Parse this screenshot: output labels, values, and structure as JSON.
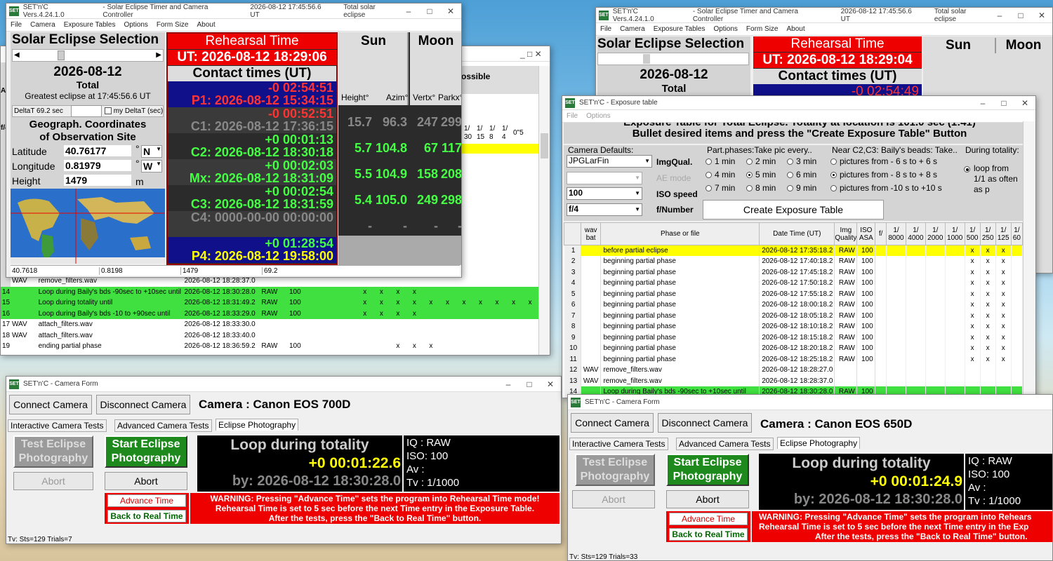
{
  "app_short": "SET'n'C",
  "left_main": {
    "title_parts": [
      "SET'n'C  Vers.4.24.1.0",
      "- Solar Eclipse Timer and Camera Controller",
      "2026-08-12  17:45:56.6 UT",
      "Total solar eclipse"
    ],
    "menu": [
      "File",
      "Camera",
      "Exposure Tables",
      "Options",
      "Form Size",
      "About"
    ],
    "ses_title": "Solar Eclipse Selection",
    "date": "2026-08-12",
    "type": "Total",
    "greatest": "Greatest eclipse at 17:45:56.6 UT",
    "deltat_label": "DeltaT 69.2 sec",
    "my_deltat": "my DeltaT (sec)",
    "geo_title1": "Geograph. Coordinates",
    "geo_title2": "of Observation Site",
    "lat_label": "Latitude",
    "lat": "40.76177",
    "lat_dir": "N",
    "lon_label": "Longitude",
    "lon": "0.81979",
    "lon_dir": "W",
    "h_label": "Height",
    "h": "1479",
    "h_unit": "m",
    "deg": "°",
    "status": [
      "40.7618",
      "0.8198",
      "1479",
      "69.2"
    ],
    "reh_title": "Rehearsal Time",
    "ut": "UT: 2026-08-12 18:29:06",
    "contact_title": "Contact times (UT)",
    "sun": "Sun",
    "moon": "Moon",
    "hdr": [
      "Height°",
      "Azim°",
      "Vertx°",
      "Parkx°"
    ],
    "contacts": [
      {
        "off": "-0 02:54:51",
        "lbl": "P1: 2026-08-12 15:34:15",
        "sh": "",
        "sa": "",
        "mv": "",
        "mp": ""
      },
      {
        "off": "-0 00:52:51",
        "lbl": "C1: 2026-08-12 17:36:15",
        "sh": "15.7",
        "sa": "96.3",
        "mv": "247",
        "mp": "299"
      },
      {
        "off": "+0 00:01:13",
        "lbl": "C2: 2026-08-12 18:30:18",
        "sh": "5.7",
        "sa": "104.8",
        "mv": "67",
        "mp": "117"
      },
      {
        "off": "+0 00:02:03",
        "lbl": "Mx: 2026-08-12 18:31:09",
        "sh": "5.5",
        "sa": "104.9",
        "mv": "158",
        "mp": "208"
      },
      {
        "off": "+0 00:02:54",
        "lbl": "C3: 2026-08-12 18:31:59",
        "sh": "5.4",
        "sa": "105.0",
        "mv": "249",
        "mp": "298"
      },
      {
        "off": "",
        "lbl": "C4: 0000-00-00 00:00:00",
        "sh": "-",
        "sa": "-",
        "mv": "-",
        "mp": "-"
      },
      {
        "off": "+0 01:28:54",
        "lbl": "P4: 2026-08-12 19:58:00",
        "sh": "",
        "sa": "",
        "mv": "",
        "mp": ""
      }
    ]
  },
  "left_table": {
    "partial_text": "ossible",
    "hdr_fracs": [
      "1/",
      "1/",
      "1/",
      "1/",
      "1/"
    ],
    "hdr_nums": [
      "30",
      "15",
      "8",
      "4"
    ],
    "hdr_last": "0\"5",
    "rows": [
      {
        "n": "",
        "wav": "WAV",
        "phase": "remove_filters.wav",
        "date": "2026-08-12 18:28:37.0",
        "iq": "",
        "iso": "",
        "marks": [],
        "color": ""
      },
      {
        "n": "14",
        "wav": "",
        "phase": "Loop during Baily's bds -90sec to +10sec until",
        "date": "2026-08-12 18:30:28.0",
        "iq": "RAW",
        "iso": "100",
        "marks": [
          "x",
          "x",
          "x",
          "x",
          "",
          "",
          "",
          "",
          "",
          "",
          ""
        ],
        "color": "grn"
      },
      {
        "n": "15",
        "wav": "",
        "phase": "Loop during totality until",
        "date": "2026-08-12 18:31:49.2",
        "iq": "RAW",
        "iso": "100",
        "marks": [
          "x",
          "x",
          "x",
          "x",
          "x",
          "x",
          "x",
          "x",
          "x",
          "x",
          "x"
        ],
        "color": "grn"
      },
      {
        "n": "16",
        "wav": "",
        "phase": "Loop during Baily's bds -10 to +90sec until",
        "date": "2026-08-12 18:33:29.0",
        "iq": "RAW",
        "iso": "100",
        "marks": [
          "x",
          "x",
          "x",
          "x",
          "",
          "",
          "",
          "",
          "",
          "",
          ""
        ],
        "color": "grn"
      },
      {
        "n": "17",
        "wav": "WAV",
        "phase": "attach_filters.wav",
        "date": "2026-08-12 18:33:30.0",
        "iq": "",
        "iso": "",
        "marks": [],
        "color": ""
      },
      {
        "n": "18",
        "wav": "WAV",
        "phase": "attach_filters.wav",
        "date": "2026-08-12 18:33:40.0",
        "iq": "",
        "iso": "",
        "marks": [],
        "color": ""
      },
      {
        "n": "19",
        "wav": "",
        "phase": "ending partial phase",
        "date": "2026-08-12 18:36:59.2",
        "iq": "RAW",
        "iso": "100",
        "marks": [
          "",
          "",
          "x",
          "x",
          "x"
        ],
        "color": ""
      }
    ]
  },
  "left_cam": {
    "title": "SET'n'C - Camera Form",
    "connect": "Connect Camera",
    "disconnect": "Disconnect Camera",
    "camera": "Camera : Canon EOS 700D",
    "tabs": [
      "Interactive Camera Tests",
      "Advanced Camera Tests",
      "Eclipse Photography"
    ],
    "test": "Test Eclipse Photography",
    "start": "Start Eclipse Photography",
    "abort1": "Abort",
    "abort2": "Abort",
    "loop": "Loop during totality",
    "timer": "+0 00:01:22.6",
    "by": "by: 2026-08-12 18:30:28.0",
    "iq": "IQ  : RAW",
    "iso": "ISO: 100",
    "av": "Av  :",
    "tv": "Tv  : 1/1000",
    "adv": "Advance Time",
    "back": "Back to Real Time",
    "warn1": "WARNING: Pressing \"Advance Time\" sets the program into Rehearsal Time mode!",
    "warn2": "Rehearsal Time is set to 5 sec before the next Time entry in the Exposure Table.",
    "warn3": "After the tests, press the \"Back to Real Time\" button.",
    "status": "Tv: Sts=129 Trials=7"
  },
  "right_main": {
    "date": "2026-08-12",
    "type": "Total",
    "ut": "UT: 2026-08-12 18:29:04",
    "off": "-0 02:54:49"
  },
  "exposure": {
    "title": "SET'n'C - Exposure table",
    "menu": [
      "File",
      "Options"
    ],
    "head1": "Exposure Table for Total Eclipse. Totality at location is 101.0 sec (1:41)",
    "head2": "Bullet desired items and press the \"Create Exposure Table\" Button",
    "cam_def": "Camera Defaults:",
    "imgqual_v": "JPGLarFin",
    "imgqual": "ImgQual.",
    "ae": "AE mode",
    "iso_v": "100",
    "iso": "ISO speed",
    "f_v": "f/4",
    "fnum": "f/Number",
    "pp_title": "Part.phases:Take pic every..",
    "pp": [
      "1 min",
      "2 min",
      "3 min",
      "4 min",
      "5 min",
      "6 min",
      "7 min",
      "8 min",
      "9 min"
    ],
    "bb_title": "Near C2,C3: Baily's beads: Take..",
    "bb": [
      "pictures from  - 6 s to  + 6 s",
      "pictures from  - 8 s to  + 8 s",
      "pictures from -10 s to +10 s"
    ],
    "tot_title": "During totality:",
    "tot": "loop from 1/1 as often as p",
    "create": "Create Exposure Table",
    "cols": [
      "wav bat",
      "Phase or file",
      "Date Time (UT)",
      "Img Quality",
      "ISO ASA",
      "f/",
      "1/ 8000",
      "1/ 4000",
      "1/ 2000",
      "1/ 1000",
      "1/ 500",
      "1/ 250",
      "1/ 125",
      "1/ 60"
    ],
    "rows": [
      {
        "n": "1",
        "wav": "",
        "phase": "before partial eclipse",
        "date": "2026-08-12 17:35:18.2",
        "iq": "RAW",
        "iso": "100",
        "x": true,
        "color": "sel"
      },
      {
        "n": "2",
        "wav": "",
        "phase": "beginning partial phase",
        "date": "2026-08-12 17:40:18.2",
        "iq": "RAW",
        "iso": "100",
        "x": true,
        "color": ""
      },
      {
        "n": "3",
        "wav": "",
        "phase": "beginning partial phase",
        "date": "2026-08-12 17:45:18.2",
        "iq": "RAW",
        "iso": "100",
        "x": true,
        "color": ""
      },
      {
        "n": "4",
        "wav": "",
        "phase": "beginning partial phase",
        "date": "2026-08-12 17:50:18.2",
        "iq": "RAW",
        "iso": "100",
        "x": true,
        "color": ""
      },
      {
        "n": "5",
        "wav": "",
        "phase": "beginning partial phase",
        "date": "2026-08-12 17:55:18.2",
        "iq": "RAW",
        "iso": "100",
        "x": true,
        "color": ""
      },
      {
        "n": "6",
        "wav": "",
        "phase": "beginning partial phase",
        "date": "2026-08-12 18:00:18.2",
        "iq": "RAW",
        "iso": "100",
        "x": true,
        "color": ""
      },
      {
        "n": "7",
        "wav": "",
        "phase": "beginning partial phase",
        "date": "2026-08-12 18:05:18.2",
        "iq": "RAW",
        "iso": "100",
        "x": true,
        "color": ""
      },
      {
        "n": "8",
        "wav": "",
        "phase": "beginning partial phase",
        "date": "2026-08-12 18:10:18.2",
        "iq": "RAW",
        "iso": "100",
        "x": true,
        "color": ""
      },
      {
        "n": "9",
        "wav": "",
        "phase": "beginning partial phase",
        "date": "2026-08-12 18:15:18.2",
        "iq": "RAW",
        "iso": "100",
        "x": true,
        "color": ""
      },
      {
        "n": "10",
        "wav": "",
        "phase": "beginning partial phase",
        "date": "2026-08-12 18:20:18.2",
        "iq": "RAW",
        "iso": "100",
        "x": true,
        "color": ""
      },
      {
        "n": "11",
        "wav": "",
        "phase": "beginning partial phase",
        "date": "2026-08-12 18:25:18.2",
        "iq": "RAW",
        "iso": "100",
        "x": true,
        "color": ""
      },
      {
        "n": "12",
        "wav": "WAV",
        "phase": "remove_filters.wav",
        "date": "2026-08-12 18:28:27.0",
        "iq": "",
        "iso": "",
        "x": false,
        "color": ""
      },
      {
        "n": "13",
        "wav": "WAV",
        "phase": "remove_filters.wav",
        "date": "2026-08-12 18:28:37.0",
        "iq": "",
        "iso": "",
        "x": false,
        "color": ""
      },
      {
        "n": "14",
        "wav": "",
        "phase": "Loop during Baily's bds -90sec to +10sec until",
        "date": "2026-08-12 18:30:28.0",
        "iq": "RAW",
        "iso": "100",
        "x": false,
        "color": "grn"
      }
    ]
  },
  "right_cam": {
    "camera": "Camera : Canon EOS 650D",
    "timer": "+0 00:01:24.9",
    "warn1": "WARNING: Pressing \"Advance Time\" sets the program into Rehears",
    "warn2": "Rehearsal Time is set to 5 sec before the next Time entry in the Exp",
    "warn3": "After the tests, press the \"Back to Real Time\" button.",
    "status": "Tv: Sts=129 Trials=33"
  }
}
